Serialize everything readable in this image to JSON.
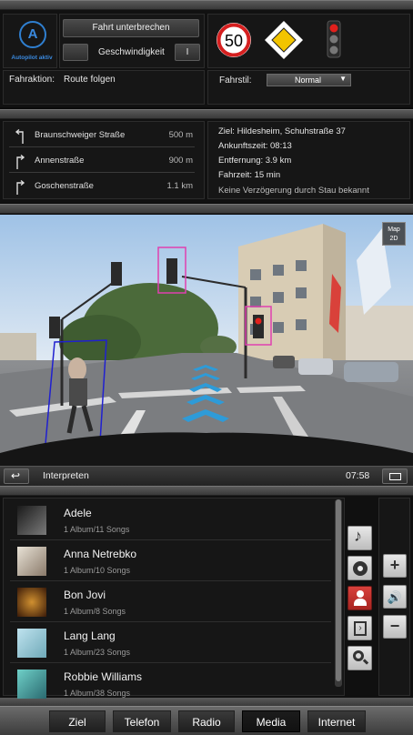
{
  "autopilot": {
    "icon_letter": "A",
    "status_label": "Autopilot aktiv",
    "pause_button": "Fahrt unterbrechen",
    "speed_label": "Geschwindigkeit",
    "speed_value": "I",
    "action_label": "Fahraktion:",
    "action_value": "Route folgen",
    "style_label": "Fahrstil:",
    "style_value": "Normal",
    "speed_limit": "50",
    "signs": [
      "speed-limit-sign",
      "priority-road-sign",
      "traffic-light-sign"
    ]
  },
  "route": {
    "steps": [
      {
        "street": "Braunschweiger Straße",
        "distance": "500 m",
        "turn": "left"
      },
      {
        "street": "Annenstraße",
        "distance": "900 m",
        "turn": "right"
      },
      {
        "street": "Goschenstraße",
        "distance": "1.1 km",
        "turn": "right"
      }
    ],
    "info": [
      "Ziel: Hildesheim, Schuhstraße 37",
      "Ankunftszeit: 08:13",
      "Entfernung: 3.9 km",
      "Fahrzeit: 15 min",
      "Keine Verzögerung durch Stau bekannt"
    ]
  },
  "camera": {
    "map_button_line1": "Map",
    "map_button_line2": "2D"
  },
  "status": {
    "back_icon": "back-arrow-icon",
    "title": "Interpreten",
    "time": "07:58",
    "window_icon": "window-icon"
  },
  "media": {
    "artists": [
      {
        "name": "Adele",
        "info": "1 Album/11 Songs",
        "cover": "#3a3a3a"
      },
      {
        "name": "Anna Netrebko",
        "info": "1 Album/10 Songs",
        "cover": "#c9c3b8"
      },
      {
        "name": "Bon Jovi",
        "info": "1 Album/8 Songs",
        "cover": "#4a2a10"
      },
      {
        "name": "Lang Lang",
        "info": "1 Album/23 Songs",
        "cover": "#9fc9d8"
      },
      {
        "name": "Robbie Williams",
        "info": "1 Album/38 Songs",
        "cover": "#3f8f92"
      }
    ],
    "side_buttons": [
      "music-note-icon",
      "disc-icon",
      "person-icon",
      "playlist-icon",
      "search-icon"
    ],
    "volume_buttons": [
      "+",
      "speaker-icon",
      "−"
    ]
  },
  "tabs": [
    {
      "label": "Ziel",
      "active": false
    },
    {
      "label": "Telefon",
      "active": false
    },
    {
      "label": "Radio",
      "active": false
    },
    {
      "label": "Media",
      "active": true
    },
    {
      "label": "Internet",
      "active": false
    }
  ],
  "colors": {
    "accent_blue": "#2f7fd0",
    "active_red": "#c8302c"
  }
}
